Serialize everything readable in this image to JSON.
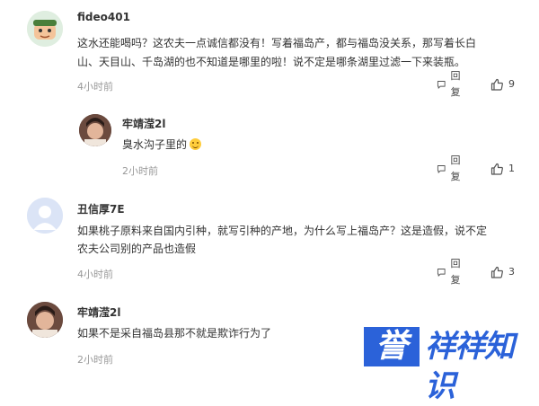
{
  "comments": [
    {
      "username": "fideo401",
      "text_line1": "这水还能喝吗？这农夫一点诚信都没有！写着福岛产，都与福岛没关系，那写着长白",
      "text_line2": "山、天目山、千岛湖的也不知道是哪里的啦！说不定是哪条湖里过滤一下来装瓶。",
      "time": "4小时前",
      "reply_label": "回复",
      "like_count": "9"
    },
    {
      "username": "牢靖滢2l",
      "text_line1": "臭水沟子里的",
      "time": "2小时前",
      "reply_label": "回复",
      "like_count": "1"
    },
    {
      "username": "丑信厚7E",
      "text_line1": "如果桃子原料来自国内引种，就写引种的产地，为什么写上福岛产？这是造假，说不定",
      "text_line2": "农夫公司别的产品也造假",
      "time": "4小时前",
      "reply_label": "回复",
      "like_count": "3"
    },
    {
      "username": "牢靖滢2l",
      "text_line1": "如果不是采自福岛县那不就是欺诈行为了",
      "time": "2小时前"
    }
  ],
  "watermark": {
    "box_char": "誉",
    "text": "祥祥知识"
  },
  "colors": {
    "watermark_blue": "#2b62d9",
    "meta_gray": "#999999",
    "text": "#333333"
  },
  "icons": {
    "reply": "comment-bubble-icon",
    "like": "thumbs-up-icon"
  }
}
